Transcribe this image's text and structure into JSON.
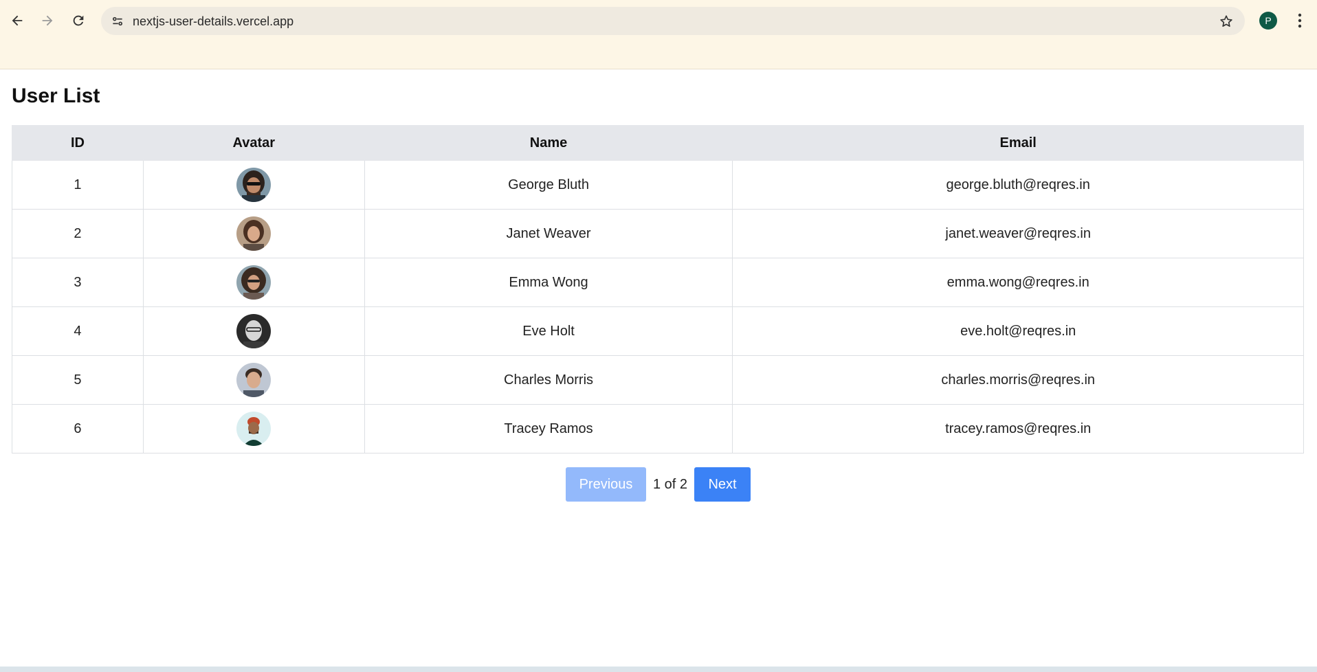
{
  "browser": {
    "url": "nextjs-user-details.vercel.app",
    "profile_initial": "P",
    "back_icon": "arrow-left-icon",
    "forward_icon": "arrow-right-icon",
    "reload_icon": "reload-icon",
    "site_info_icon": "tune-icon",
    "bookmark_icon": "star-icon",
    "menu_icon": "more-vert-icon"
  },
  "page": {
    "title": "User List"
  },
  "table": {
    "headers": {
      "id": "ID",
      "avatar": "Avatar",
      "name": "Name",
      "email": "Email"
    },
    "rows": [
      {
        "id": "1",
        "name": "George Bluth",
        "email": "george.bluth@reqres.in"
      },
      {
        "id": "2",
        "name": "Janet Weaver",
        "email": "janet.weaver@reqres.in"
      },
      {
        "id": "3",
        "name": "Emma Wong",
        "email": "emma.wong@reqres.in"
      },
      {
        "id": "4",
        "name": "Eve Holt",
        "email": "eve.holt@reqres.in"
      },
      {
        "id": "5",
        "name": "Charles Morris",
        "email": "charles.morris@reqres.in"
      },
      {
        "id": "6",
        "name": "Tracey Ramos",
        "email": "tracey.ramos@reqres.in"
      }
    ]
  },
  "pagination": {
    "previous_label": "Previous",
    "indicator": "1 of 2",
    "next_label": "Next",
    "previous_disabled": true
  },
  "colors": {
    "accent": "#3b82f6",
    "accent_disabled": "#93b9fb",
    "header_bg": "#e5e7eb",
    "chrome_bg": "#fdf6e6",
    "profile_bg": "#0f5a46"
  }
}
